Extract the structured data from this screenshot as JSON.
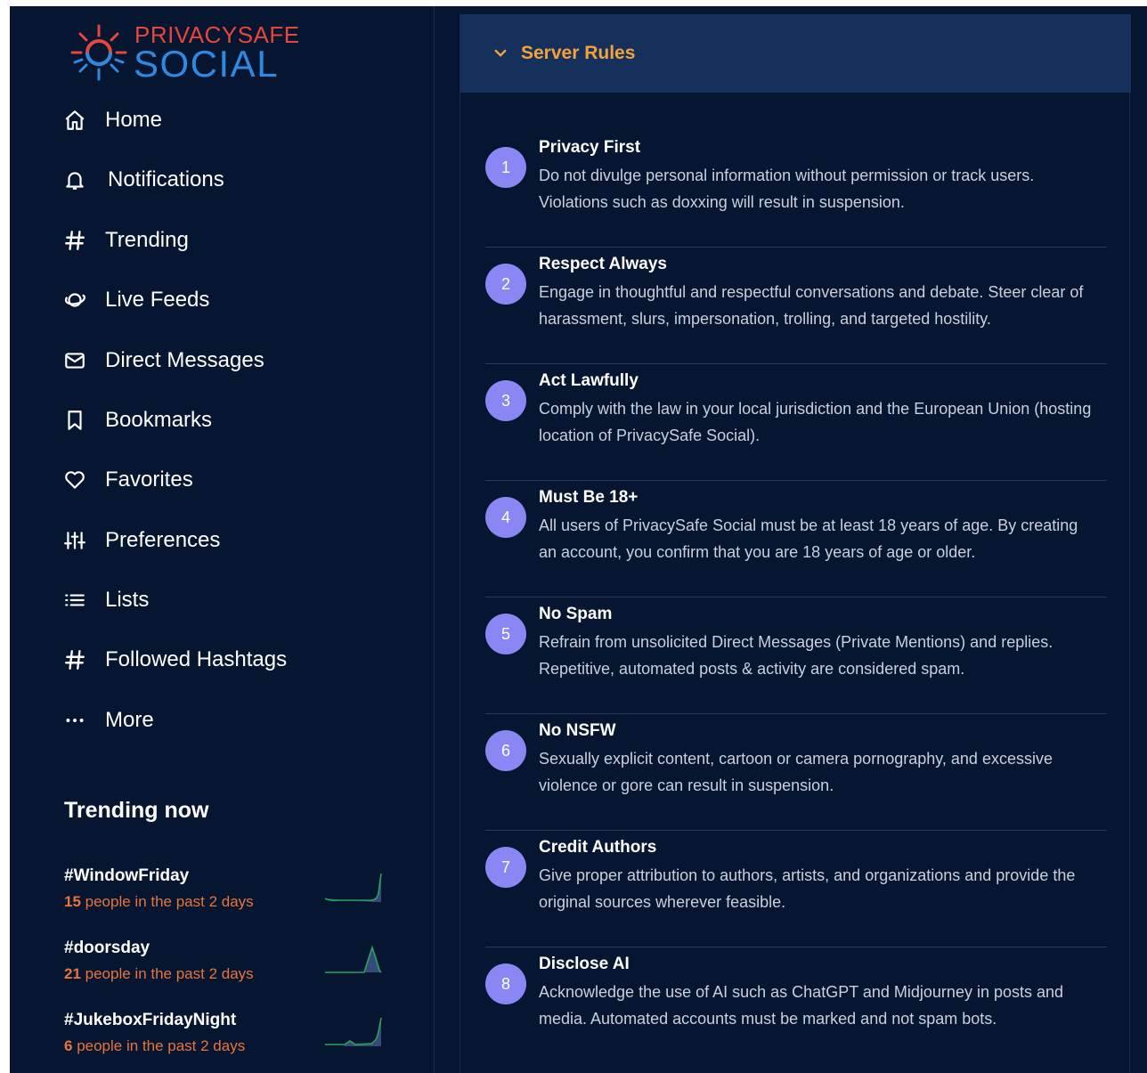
{
  "brand": {
    "top": "PRIVACYSAFE",
    "bottom": "SOCIAL"
  },
  "nav": {
    "items": [
      {
        "label": "Home",
        "icon": "home-icon"
      },
      {
        "label": "Notifications",
        "icon": "bell-icon"
      },
      {
        "label": "Trending",
        "icon": "hash-icon"
      },
      {
        "label": "Live Feeds",
        "icon": "planet-icon"
      },
      {
        "label": "Direct Messages",
        "icon": "envelope-icon"
      },
      {
        "label": "Bookmarks",
        "icon": "bookmark-icon"
      },
      {
        "label": "Favorites",
        "icon": "heart-icon"
      },
      {
        "label": "Preferences",
        "icon": "sliders-icon"
      },
      {
        "label": "Lists",
        "icon": "list-icon"
      },
      {
        "label": "Followed Hashtags",
        "icon": "hash-icon"
      },
      {
        "label": "More",
        "icon": "more-icon"
      }
    ]
  },
  "trending": {
    "title": "Trending now",
    "items": [
      {
        "tag": "#WindowFriday",
        "count": "15",
        "suffix": " people in the past 2 days"
      },
      {
        "tag": "#doorsday",
        "count": "21",
        "suffix": " people in the past 2 days"
      },
      {
        "tag": "#JukeboxFridayNight",
        "count": "6",
        "suffix": " people in the past 2 days"
      }
    ]
  },
  "rules_panel": {
    "title": "Server Rules",
    "rules": [
      {
        "num": "1",
        "title": "Privacy First",
        "text": "Do not divulge personal information without permission or track users. Violations such as doxxing will result in suspension."
      },
      {
        "num": "2",
        "title": "Respect Always",
        "text": "Engage in thoughtful and respectful conversations and debate. Steer clear of harassment, slurs, impersonation, trolling, and targeted hostility."
      },
      {
        "num": "3",
        "title": "Act Lawfully",
        "text": "Comply with the law in your local jurisdiction and the European Union (hosting location of PrivacySafe Social)."
      },
      {
        "num": "4",
        "title": "Must Be 18+",
        "text": "All users of PrivacySafe Social must be at least 18 years of age. By creating an account, you confirm that you are 18 years of age or older."
      },
      {
        "num": "5",
        "title": "No Spam",
        "text": "Refrain from unsolicited Direct Messages (Private Mentions) and replies. Repetitive, automated posts & activity are considered spam."
      },
      {
        "num": "6",
        "title": "No NSFW",
        "text": "Sexually explicit content, cartoon or camera pornography, and excessive violence or gore can result in suspension."
      },
      {
        "num": "7",
        "title": "Credit Authors",
        "text": "Give proper attribution to authors, artists, and organizations and provide the original sources wherever feasible."
      },
      {
        "num": "8",
        "title": "Disclose AI",
        "text": "Acknowledge the use of AI such as ChatGPT and Midjourney in posts and media. Automated accounts must be marked and not spam bots."
      }
    ]
  },
  "colors": {
    "background": "#061530",
    "panel_header": "#16305c",
    "accent_orange": "#f3a23b",
    "rule_number": "#8a87f5",
    "trend_count": "#e8743a",
    "logo_red": "#e5473a",
    "logo_blue": "#2d8ae0"
  }
}
